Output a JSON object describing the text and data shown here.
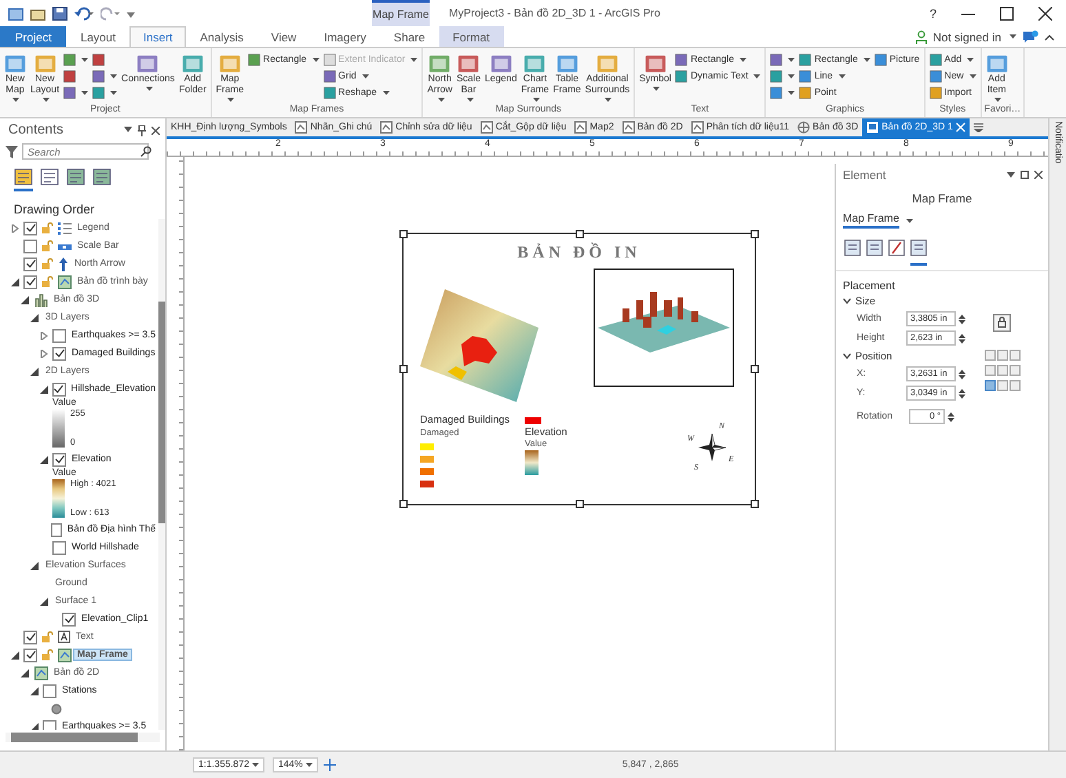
{
  "window": {
    "title": "MyProject3 - Bản đồ 2D_3D 1 - ArcGIS Pro",
    "help": "?",
    "context_group": "Map Frame"
  },
  "ribbon_tabs": [
    {
      "label": "Project",
      "kind": "backstage",
      "selected": false
    },
    {
      "label": "Layout",
      "kind": "tab",
      "selected": false
    },
    {
      "label": "Insert",
      "kind": "tab",
      "selected": true
    },
    {
      "label": "Analysis",
      "kind": "tab",
      "selected": false
    },
    {
      "label": "View",
      "kind": "tab",
      "selected": false
    },
    {
      "label": "Imagery",
      "kind": "tab",
      "selected": false
    },
    {
      "label": "Share",
      "kind": "tab",
      "selected": false
    },
    {
      "label": "Format",
      "kind": "contextual",
      "selected": false
    }
  ],
  "account": {
    "label": "Not signed in"
  },
  "ribbon_groups": [
    {
      "label": "Project",
      "items": [
        {
          "kind": "large",
          "label": "New Map",
          "dropdown": true
        },
        {
          "kind": "large",
          "label": "New Layout",
          "dropdown": true
        },
        {
          "kind": "stack",
          "buttons": [
            {
              "dropdown": true
            },
            {
              "dropdown": false
            },
            {
              "dropdown": true
            }
          ]
        },
        {
          "kind": "stack",
          "buttons": [
            {
              "dropdown": false
            },
            {
              "dropdown": true
            },
            {
              "dropdown": true
            }
          ]
        },
        {
          "kind": "large",
          "label": "Connections",
          "dropdown": true
        },
        {
          "kind": "large",
          "label": "Add Folder",
          "dropdown": false
        }
      ]
    },
    {
      "label": "Map Frames",
      "items": [
        {
          "kind": "large",
          "label": "Map Frame",
          "dropdown": true
        },
        {
          "kind": "stack",
          "buttons": [
            {
              "label": "Rectangle",
              "dropdown": true,
              "disabled": false
            }
          ]
        },
        {
          "kind": "stack",
          "buttons": [
            {
              "label": "Extent Indicator",
              "dropdown": true,
              "disabled": true
            },
            {
              "label": "Grid",
              "dropdown": true,
              "disabled": false
            },
            {
              "label": "Reshape",
              "dropdown": true,
              "disabled": false
            }
          ]
        }
      ]
    },
    {
      "label": "Map Surrounds",
      "items": [
        {
          "kind": "large",
          "label": "North Arrow",
          "dropdown": true
        },
        {
          "kind": "large",
          "label": "Scale Bar",
          "dropdown": true
        },
        {
          "kind": "large",
          "label": "Legend",
          "dropdown": false
        },
        {
          "kind": "large",
          "label": "Chart Frame",
          "dropdown": true
        },
        {
          "kind": "large",
          "label": "Table Frame",
          "dropdown": false
        },
        {
          "kind": "large",
          "label": "Additional Surrounds",
          "dropdown": true
        }
      ]
    },
    {
      "label": "Text",
      "items": [
        {
          "kind": "large",
          "label": "Symbol",
          "dropdown": true
        },
        {
          "kind": "stack",
          "buttons": [
            {
              "label": "Rectangle",
              "dropdown": true
            },
            {
              "label": "Dynamic Text",
              "dropdown": true
            }
          ]
        }
      ]
    },
    {
      "label": "Graphics",
      "items": [
        {
          "kind": "stack",
          "buttons": [
            {
              "dropdown": true
            },
            {
              "dropdown": true
            },
            {
              "dropdown": true
            }
          ]
        },
        {
          "kind": "stack",
          "buttons": [
            {
              "label": "Rectangle",
              "dropdown": true
            },
            {
              "label": "Line",
              "dropdown": true
            },
            {
              "label": "Point",
              "dropdown": false
            }
          ]
        },
        {
          "kind": "stack",
          "buttons": [
            {
              "label": "Picture",
              "dropdown": false
            }
          ]
        }
      ]
    },
    {
      "label": "Styles",
      "items": [
        {
          "kind": "stack",
          "buttons": [
            {
              "label": "Add",
              "dropdown": true
            },
            {
              "label": "New",
              "dropdown": true
            },
            {
              "label": "Import",
              "dropdown": false
            }
          ]
        }
      ]
    },
    {
      "label": "Favori…",
      "items": [
        {
          "kind": "large",
          "label": "Add Item",
          "dropdown": true
        }
      ]
    }
  ],
  "doc_tabs": [
    {
      "label": "KHH_Định lượng_Symbols",
      "kind": "plain",
      "selected": false
    },
    {
      "label": "Nhãn_Ghi chú",
      "kind": "map",
      "selected": false
    },
    {
      "label": "Chỉnh sửa dữ liệu",
      "kind": "map",
      "selected": false
    },
    {
      "label": "Cắt_Gộp dữ liệu",
      "kind": "map",
      "selected": false
    },
    {
      "label": "Map2",
      "kind": "map",
      "selected": false
    },
    {
      "label": "Bản đồ 2D",
      "kind": "map",
      "selected": false
    },
    {
      "label": "Phân tích dữ liệu11",
      "kind": "map",
      "selected": false
    },
    {
      "label": "Bản đồ 3D",
      "kind": "scene",
      "selected": false
    },
    {
      "label": "Bản đồ 2D_3D 1",
      "kind": "layout",
      "selected": true
    }
  ],
  "notifications_tab": "Notificatio",
  "contents": {
    "title": "Contents",
    "search": {
      "placeholder": "Search"
    },
    "view_tabs": [
      {
        "selected": true
      },
      {
        "selected": false
      },
      {
        "selected": false
      },
      {
        "selected": false
      }
    ],
    "heading": "Drawing Order",
    "tree": [
      {
        "label": "Legend",
        "kind": "legend",
        "checked": true,
        "expanded": false,
        "selected": false
      },
      {
        "label": "Scale Bar",
        "kind": "scale_bar",
        "checked": false,
        "selected": false
      },
      {
        "label": "North Arrow",
        "kind": "north_arrow",
        "checked": true,
        "selected": false
      },
      {
        "label": "Bản đồ trình bày",
        "kind": "map_frame",
        "checked": true,
        "expanded": true,
        "selected": false,
        "children": [
          {
            "label": "Bản đồ 3D",
            "kind": "scene",
            "expanded": true,
            "selected": false,
            "children": [
              {
                "label": "3D Layers",
                "kind": "heading",
                "expanded": true,
                "selected": false,
                "children": [
                  {
                    "label": "Earthquakes >= 3.5",
                    "kind": "layer",
                    "checked": false,
                    "expanded": false,
                    "selected": false
                  },
                  {
                    "label": "Damaged Buildings",
                    "kind": "layer",
                    "checked": true,
                    "expanded": false,
                    "selected": false
                  }
                ]
              },
              {
                "label": "2D Layers",
                "kind": "heading",
                "expanded": true,
                "selected": false,
                "children": [
                  {
                    "label": "Hillshade_Elevation",
                    "kind": "layer",
                    "checked": true,
                    "expanded": true,
                    "selected": false,
                    "children": [
                      {
                        "kind": "gray_ramp",
                        "title": "Value",
                        "high": "255",
                        "low": "0"
                      }
                    ]
                  },
                  {
                    "label": "Elevation",
                    "kind": "layer",
                    "checked": true,
                    "expanded": true,
                    "selected": false,
                    "children": [
                      {
                        "kind": "color_ramp",
                        "title": "Value",
                        "high": "High : 4021",
                        "low": "Low : 613"
                      }
                    ]
                  },
                  {
                    "label": "Bản đồ Địa hình Thế",
                    "kind": "layer",
                    "checked": false,
                    "selected": false
                  },
                  {
                    "label": "World Hillshade",
                    "kind": "layer",
                    "checked": false,
                    "selected": false
                  }
                ]
              },
              {
                "label": "Elevation Surfaces",
                "kind": "heading",
                "expanded": true,
                "selected": false,
                "children": [
                  {
                    "label": "Ground",
                    "kind": "heading",
                    "selected": false
                  },
                  {
                    "label": "Surface 1",
                    "kind": "heading",
                    "expanded": true,
                    "selected": false,
                    "children": [
                      {
                        "label": "Elevation_Clip1",
                        "kind": "layer",
                        "checked": true,
                        "selected": false
                      }
                    ]
                  }
                ]
              }
            ]
          }
        ]
      },
      {
        "label": "Text",
        "kind": "text_element",
        "checked": true,
        "selected": false
      },
      {
        "label": "Map Frame",
        "kind": "map_frame",
        "checked": true,
        "expanded": true,
        "selected": true,
        "children": [
          {
            "label": "Bản đồ 2D",
            "kind": "map",
            "expanded": true,
            "selected": false,
            "children": [
              {
                "label": "Stations",
                "kind": "layer",
                "checked": false,
                "expanded": true,
                "selected": false,
                "children": [
                  {
                    "kind": "symbol"
                  }
                ]
              },
              {
                "label": "Earthquakes >= 3.5",
                "kind": "layer",
                "checked": false,
                "expanded": true,
                "selected": false
              }
            ]
          }
        ]
      }
    ]
  },
  "ruler_labels": [
    "2",
    "3",
    "4",
    "5",
    "6",
    "7",
    "8",
    "9"
  ],
  "layout_page": {
    "title": "BẢN ĐỒ IN",
    "legend": {
      "damaged_title": "Damaged Buildings",
      "damaged_subtitle": "Damaged",
      "damaged_classes": [
        {
          "color": "#ffee00"
        },
        {
          "color": "#f5a623"
        },
        {
          "color": "#f07000"
        },
        {
          "color": "#d83010"
        }
      ],
      "extra_class": {
        "color": "#ee0000"
      },
      "elevation_title": "Elevation",
      "elevation_subtitle": "Value"
    },
    "compass": {
      "n": "N",
      "e": "E",
      "s": "S",
      "w": "W"
    }
  },
  "element_pane": {
    "title": "Element",
    "subject": "Map Frame",
    "selector": "Map Frame",
    "tabs": [
      {
        "selected": false
      },
      {
        "selected": false
      },
      {
        "selected": false
      },
      {
        "selected": true
      }
    ],
    "section": "Placement",
    "groups": [
      {
        "label": "Size",
        "expanded": true,
        "fields": [
          {
            "label": "Width",
            "value": "3,3805 in"
          },
          {
            "label": "Height",
            "value": "2,623 in"
          }
        ]
      },
      {
        "label": "Position",
        "expanded": true,
        "fields": [
          {
            "label": "X:",
            "value": "3,2631 in"
          },
          {
            "label": "Y:",
            "value": "3,0349 in"
          }
        ]
      }
    ],
    "rotation": {
      "label": "Rotation",
      "value": "0 °"
    },
    "anchor": [
      {
        "selected": false
      },
      {
        "selected": false
      },
      {
        "selected": false
      },
      {
        "selected": false
      },
      {
        "selected": false
      },
      {
        "selected": false
      },
      {
        "selected": true
      },
      {
        "selected": false
      },
      {
        "selected": false
      }
    ]
  },
  "status_bar": {
    "scale": "1:1.355.872",
    "zoom": "144%",
    "coordinates": "5,847 , 2,865"
  }
}
